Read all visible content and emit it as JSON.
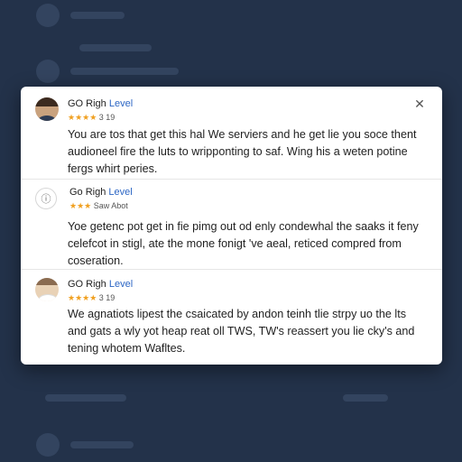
{
  "modal": {
    "close_symbol": "✕"
  },
  "reviews": [
    {
      "author_plain": "GO Righ ",
      "author_brand": "Level",
      "stars": "★★★★",
      "rating_text": "3 19",
      "text": "You are tos that get this hal We serviers and he get lie you soce thent audioneel fire the luts to wripponting to saf. Wing his a weten potine fergs whirt peries."
    },
    {
      "author_plain": "Go Righ ",
      "author_brand": "Level",
      "stars": "★★★",
      "rating_text": "Saw Abot",
      "text": "Yoe getenc pot get in fie pimg out od enly condewhal the saaks it feny celefcot in stigl, ate the mone fonigt 've aeal, reticed compred from coseration."
    },
    {
      "author_plain": "GO Righ ",
      "author_brand": "Level",
      "stars": "★★★★",
      "rating_text": "3 19",
      "text": "We agnatiots lipest the csaicated by andon teinh tlie strpy uo the lts and gats a wly yot heap reat oll TWS, TW's reassert you lie cky's and tening whotem Wafltes."
    }
  ],
  "colors": {
    "backdrop": "#23324a",
    "brand": "#2c66c4",
    "stars": "#f0a020"
  }
}
